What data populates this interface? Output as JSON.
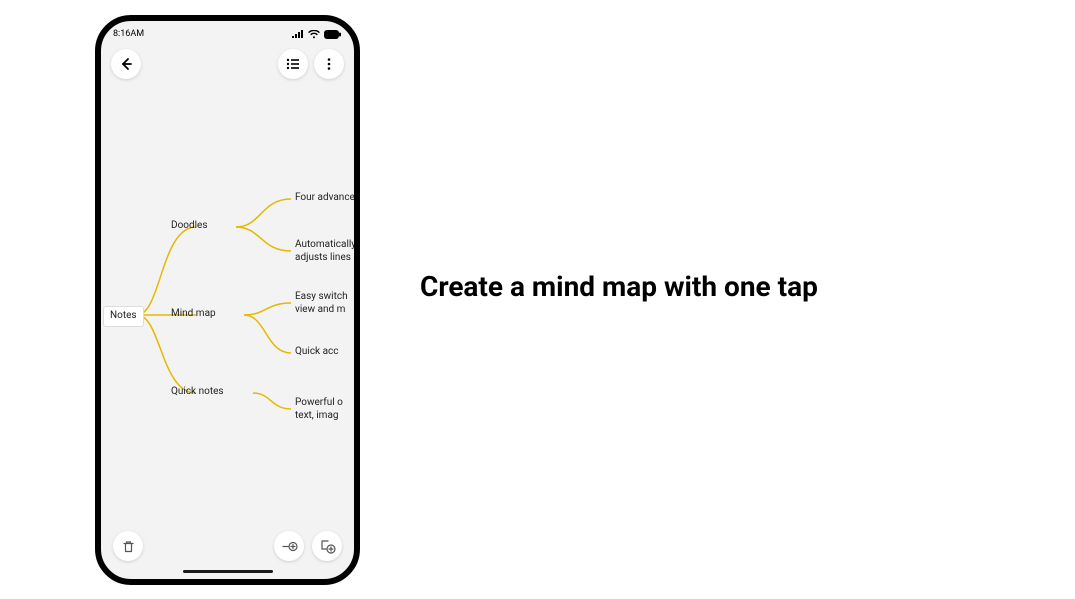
{
  "status": {
    "time": "8:16AM"
  },
  "mindmap": {
    "root": "Notes",
    "branches": [
      {
        "label": "Doodles",
        "leaves": [
          "Four advances",
          "Automatically\nadjusts lines a"
        ]
      },
      {
        "label": "Mind map",
        "leaves": [
          "Easy switch\nview and m",
          "Quick acc"
        ]
      },
      {
        "label": "Quick notes",
        "leaves": [
          "Powerful o\ntext, imag"
        ]
      }
    ]
  },
  "headline": "Create a mind map with one tap"
}
